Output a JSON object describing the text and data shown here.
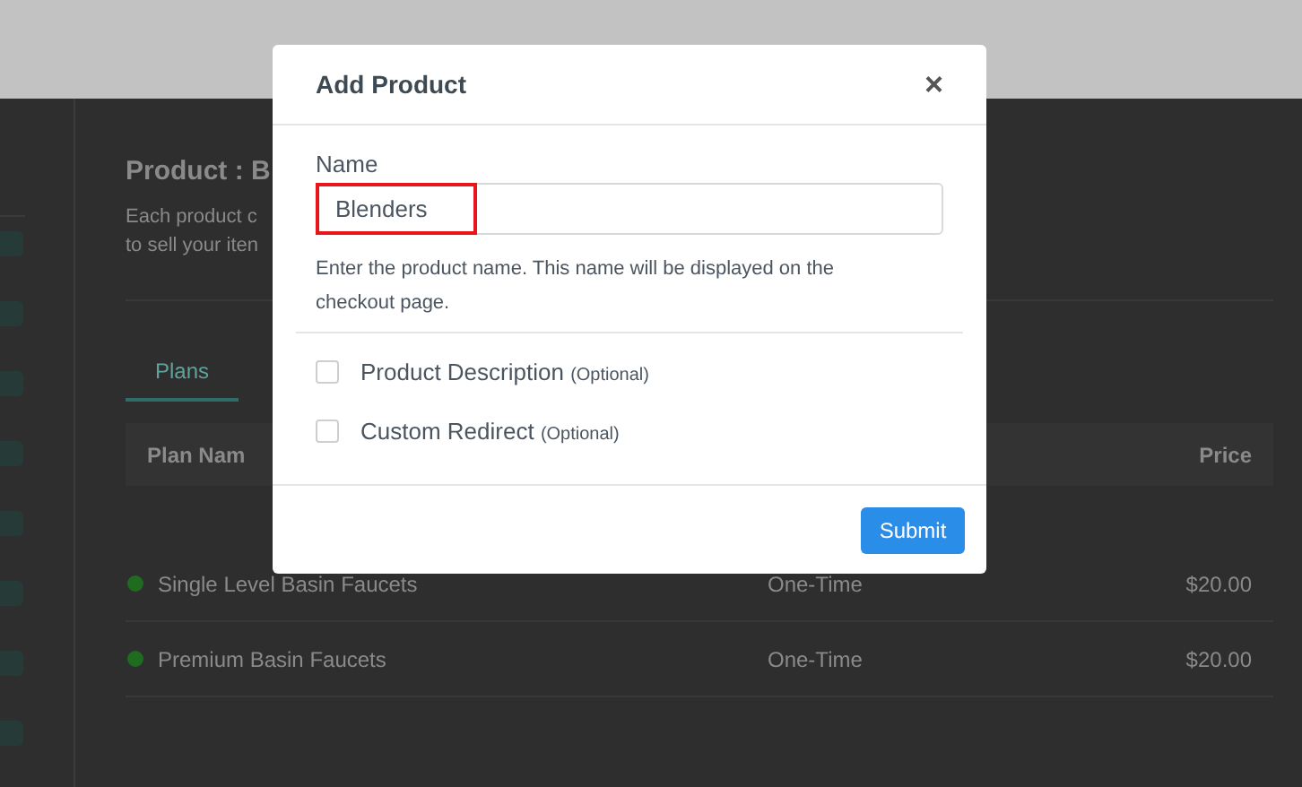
{
  "page": {
    "title": "Product : B",
    "description_lines": [
      "Each product c",
      "to sell your iten"
    ]
  },
  "tabs": [
    {
      "label": "Plans",
      "selected": true
    }
  ],
  "table": {
    "columns": [
      "Plan Nam",
      "Price"
    ],
    "rows": [
      {
        "name": "Single Level Basin Faucets",
        "type": "One-Time",
        "price": "$20.00",
        "color": "#1f6b1f"
      },
      {
        "name": "Premium Basin Faucets",
        "type": "One-Time",
        "price": "$20.00",
        "color": "#1f6b1f"
      }
    ]
  },
  "modal": {
    "title": "Add Product",
    "close": "×",
    "name_label": "Name",
    "name_value": "Blenders",
    "help": "Enter the product name. This name will be displayed on the checkout page.",
    "options": [
      {
        "label": "Product Description",
        "note": "(Optional)",
        "checked": false
      },
      {
        "label": "Custom Redirect",
        "note": "(Optional)",
        "checked": false
      }
    ],
    "submit": "Submit"
  }
}
